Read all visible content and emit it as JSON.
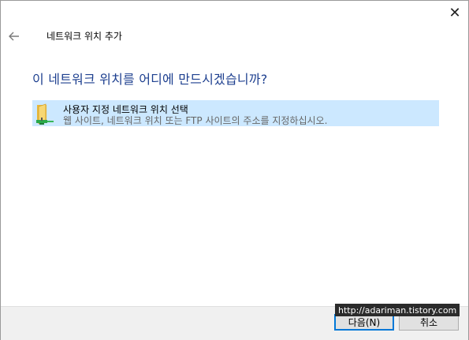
{
  "window": {
    "close_glyph": "✕"
  },
  "header": {
    "back_icon": "arrow-left-icon",
    "title": "네트워크 위치 추가"
  },
  "main": {
    "heading": "이 네트워크 위치를 어디에 만드시겠습니까?",
    "options": [
      {
        "icon": "folder-network-icon",
        "title": "사용자 지정 네트워크 위치 선택",
        "description": "웹 사이트, 네트워크 위치 또는 FTP 사이트의 주소를 지정하십시오.",
        "selected": true
      }
    ]
  },
  "footer": {
    "next_label": "다음(N)",
    "cancel_label": "취소"
  },
  "watermark": {
    "text": "http://adariman.tistory.com"
  },
  "colors": {
    "heading": "#1d3f8f",
    "selection": "#cce8ff",
    "footer_bg": "#f0f0f0",
    "default_button_border": "#0078d7"
  }
}
